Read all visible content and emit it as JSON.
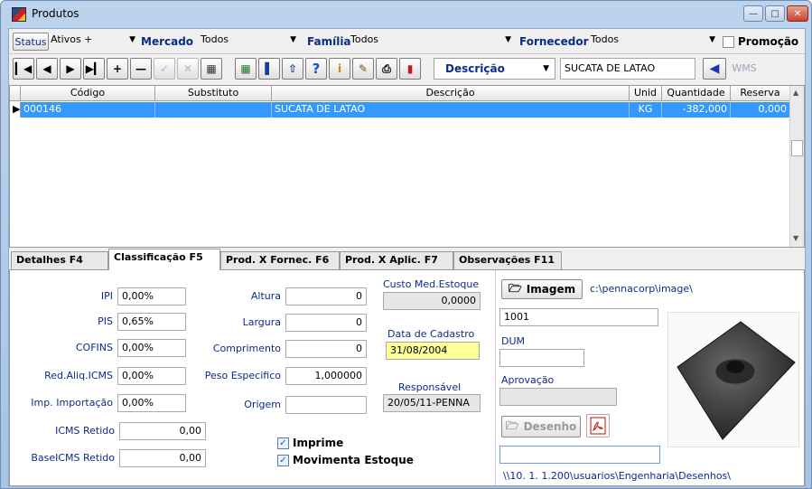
{
  "window": {
    "title": "Produtos"
  },
  "filters": {
    "status_button": "Status",
    "status_value": "Ativos +",
    "mercado_label": "Mercado",
    "mercado_value": "Todos",
    "familia_label": "Família",
    "familia_value": "Todos",
    "fornecedor_label": "Fornecedor",
    "fornecedor_value": "Todos",
    "promocao_label": "Promoção",
    "promocao_checked": false
  },
  "toolbar": {
    "search_field_label": "Descrição",
    "search_value": "SUCATA DE LATAO",
    "wms_label": "WMS"
  },
  "grid": {
    "columns": [
      "Código",
      "Substituto",
      "Descrição",
      "Unid",
      "Quantidade",
      "Reserva"
    ],
    "rows": [
      {
        "codigo": "000146",
        "substituto": "",
        "descricao": "SUCATA DE LATAO",
        "unid": "KG",
        "quantidade": "-382,000",
        "reserva": "0,000"
      }
    ]
  },
  "tabs": [
    {
      "label": "Detalhes  F4"
    },
    {
      "label": "Classificação  F5"
    },
    {
      "label": "Prod. X Fornec.  F6"
    },
    {
      "label": "Prod.  X  Aplic.  F7"
    },
    {
      "label": "Observações  F11"
    }
  ],
  "classificacao": {
    "ipi_label": "IPI",
    "ipi": "0,00%",
    "pis_label": "PIS",
    "pis": "0,65%",
    "cofins_label": "COFINS",
    "cofins": "0,00%",
    "red_aliq_label": "Red.Aliq.ICMS",
    "red_aliq": "0,00%",
    "imp_importacao_label": "Imp. Importação",
    "imp_importacao": "0,00%",
    "icms_retido_label": "ICMS Retido",
    "icms_retido": "0,00",
    "base_icms_label": "BaseICMS Retido",
    "base_icms": "0,00",
    "altura_label": "Altura",
    "altura": "0",
    "largura_label": "Largura",
    "largura": "0",
    "comprimento_label": "Comprimento",
    "comprimento": "0",
    "peso_label": "Peso Especifico",
    "peso": "1,000000",
    "origem_label": "Origem",
    "origem": "",
    "custo_label": "Custo Med.Estoque",
    "custo": "0,0000",
    "data_cadastro_label": "Data de Cadastro",
    "data_cadastro": "31/08/2004",
    "responsavel_label": "Responsável",
    "responsavel": "20/05/11-PENNA",
    "imprime_label": "Imprime",
    "imprime_checked": true,
    "movimenta_label": "Movimenta Estoque",
    "movimenta_checked": true
  },
  "imagem": {
    "button_label": "Imagem",
    "path": "c:\\pennacorp\\image\\",
    "codigo": "1001",
    "dum_label": "DUM",
    "dum": "",
    "aprovacao_label": "Aprovação",
    "aprovacao": "",
    "desenho_label": "Desenho",
    "desenho_value": "",
    "desenhos_path": "\\\\10. 1. 1.200\\usuarios\\Engenharia\\Desenhos\\"
  }
}
